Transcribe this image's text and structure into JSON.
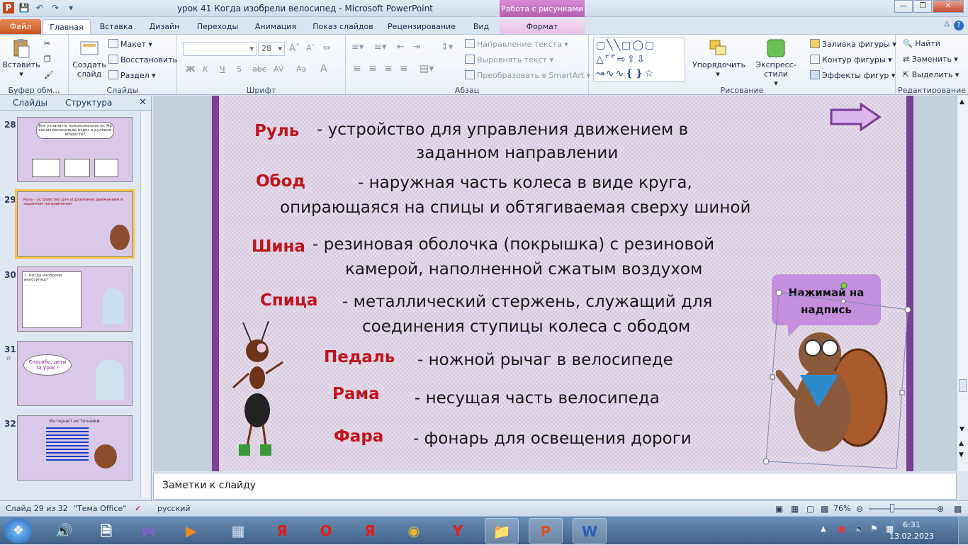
{
  "window": {
    "title": "урок 41 Когда изобрели велосипед - Microsoft PowerPoint",
    "contextual_tab_title": "Работа с рисунками"
  },
  "tabs": [
    "Файл",
    "Главная",
    "Вставка",
    "Дизайн",
    "Переходы",
    "Анимация",
    "Показ слайдов",
    "Рецензирование",
    "Вид",
    "Формат"
  ],
  "ribbon": {
    "clipboard": {
      "paste": "Вставить",
      "group": "Буфер обм..."
    },
    "slides": {
      "new_slide": "Создать слайд",
      "layout": "Макет",
      "reset": "Восстановить",
      "section": "Раздел",
      "group": "Слайды"
    },
    "font": {
      "size": "28",
      "group": "Шрифт",
      "bold": "Ж",
      "italic": "К",
      "underline": "Ч",
      "strike": "S",
      "abc": "abc",
      "spacing": "AV",
      "case": "Aa"
    },
    "paragraph": {
      "text_direction": "Направление текста",
      "align_text": "Выровнять текст",
      "smartart": "Преобразовать в SmartArt",
      "group": "Абзац"
    },
    "drawing": {
      "arrange": "Упорядочить",
      "quick_styles": "Экспресс-стили",
      "shape_fill": "Заливка фигуры",
      "shape_outline": "Контур фигуры",
      "shape_effects": "Эффекты фигур",
      "group": "Рисование"
    },
    "editing": {
      "find": "Найти",
      "replace": "Заменить",
      "select": "Выделить",
      "group": "Редактирование"
    }
  },
  "panel": {
    "tab_slides": "Слайды",
    "tab_outline": "Структура"
  },
  "thumbnails": [
    {
      "num": "28",
      "text": "Все узнали по предложенности. На каком велосипеде ездят в рулевом возрасте?"
    },
    {
      "num": "29",
      "text": "Руль - устройство для управления движением в заданном направлении"
    },
    {
      "num": "30",
      "text": "1. Когда изобрели велосипед?"
    },
    {
      "num": "31",
      "text": "Спасибо, дети за урок !"
    },
    {
      "num": "32",
      "text": "Интернет-источники"
    }
  ],
  "slide": {
    "terms": [
      {
        "term": "Руль",
        "def1": "-  устройство для управления движением в",
        "def2": "заданном направлении"
      },
      {
        "term": "Обод",
        "def1": "-   наружная часть колеса в виде круга,",
        "def2": "опирающаяся на спицы и обтягиваемая сверху шиной"
      },
      {
        "term": "Шина",
        "def1": "-   резиновая оболочка (покрышка) с резиновой",
        "def2": "камерой, наполненной сжатым воздухом"
      },
      {
        "term": "Спица",
        "def1": "- металлический стержень, служащий для",
        "def2": "соединения ступицы колеса с ободом"
      },
      {
        "term": "Педаль",
        "def1": "- ножной рычаг в велосипеде",
        "def2": ""
      },
      {
        "term": "Рама",
        "def1": "- несущая часть велосипеда",
        "def2": ""
      },
      {
        "term": "Фара",
        "def1": "- фонарь для освещения дороги",
        "def2": ""
      }
    ],
    "bubble_line1": "Нажимай на",
    "bubble_line2": "надпись"
  },
  "notes_placeholder": "Заметки к слайду",
  "status": {
    "slide": "Слайд 29 из 32",
    "theme": "\"Тема Office\"",
    "language": "русский",
    "zoom": "76%"
  },
  "clock": {
    "time": "6:31",
    "date": "13.02.2023"
  },
  "colors": {
    "term": "#c0141c",
    "slide_border": "#7b3f96",
    "bubble": "#c58fe0"
  }
}
